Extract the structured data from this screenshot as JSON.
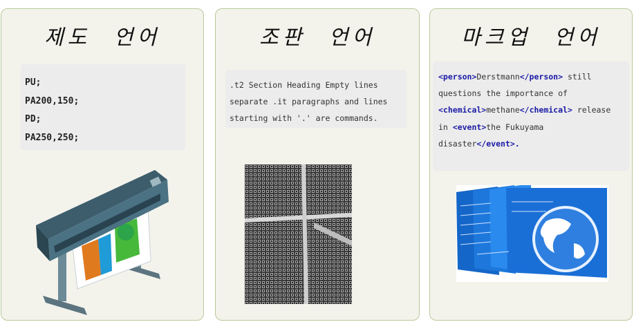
{
  "cards": [
    {
      "title": "제도 언어",
      "code_lines": [
        "PU;",
        "PA200,150;",
        "PD;",
        "PA250,250;"
      ],
      "image": "plotter-printer-illustration"
    },
    {
      "title": "조판 언어",
      "code_text": ".t2 Section Heading Empty lines separate .it paragraphs and lines starting with '.' are commands.",
      "image": "metal-type-blocks-photo"
    },
    {
      "title": "마크업 언어",
      "markup": {
        "t1o": "<person>",
        "v1": "Derstmann",
        "t1c": "</person>",
        "s1": " still questions the importance of ",
        "t2o": "<chemical>",
        "v2": "methane",
        "t2c": "</chemical>",
        "s2": " release in ",
        "t3o": "<event>",
        "v3": "the Fukuyama disaster",
        "t3c": "</event>",
        "end": "."
      },
      "image": "globe-documents-illustration"
    }
  ],
  "colors": {
    "card_bg": "#f3f3ec",
    "card_border": "#b9c99a",
    "tag": "#1a1aa6",
    "code_bg": "#ececec"
  }
}
